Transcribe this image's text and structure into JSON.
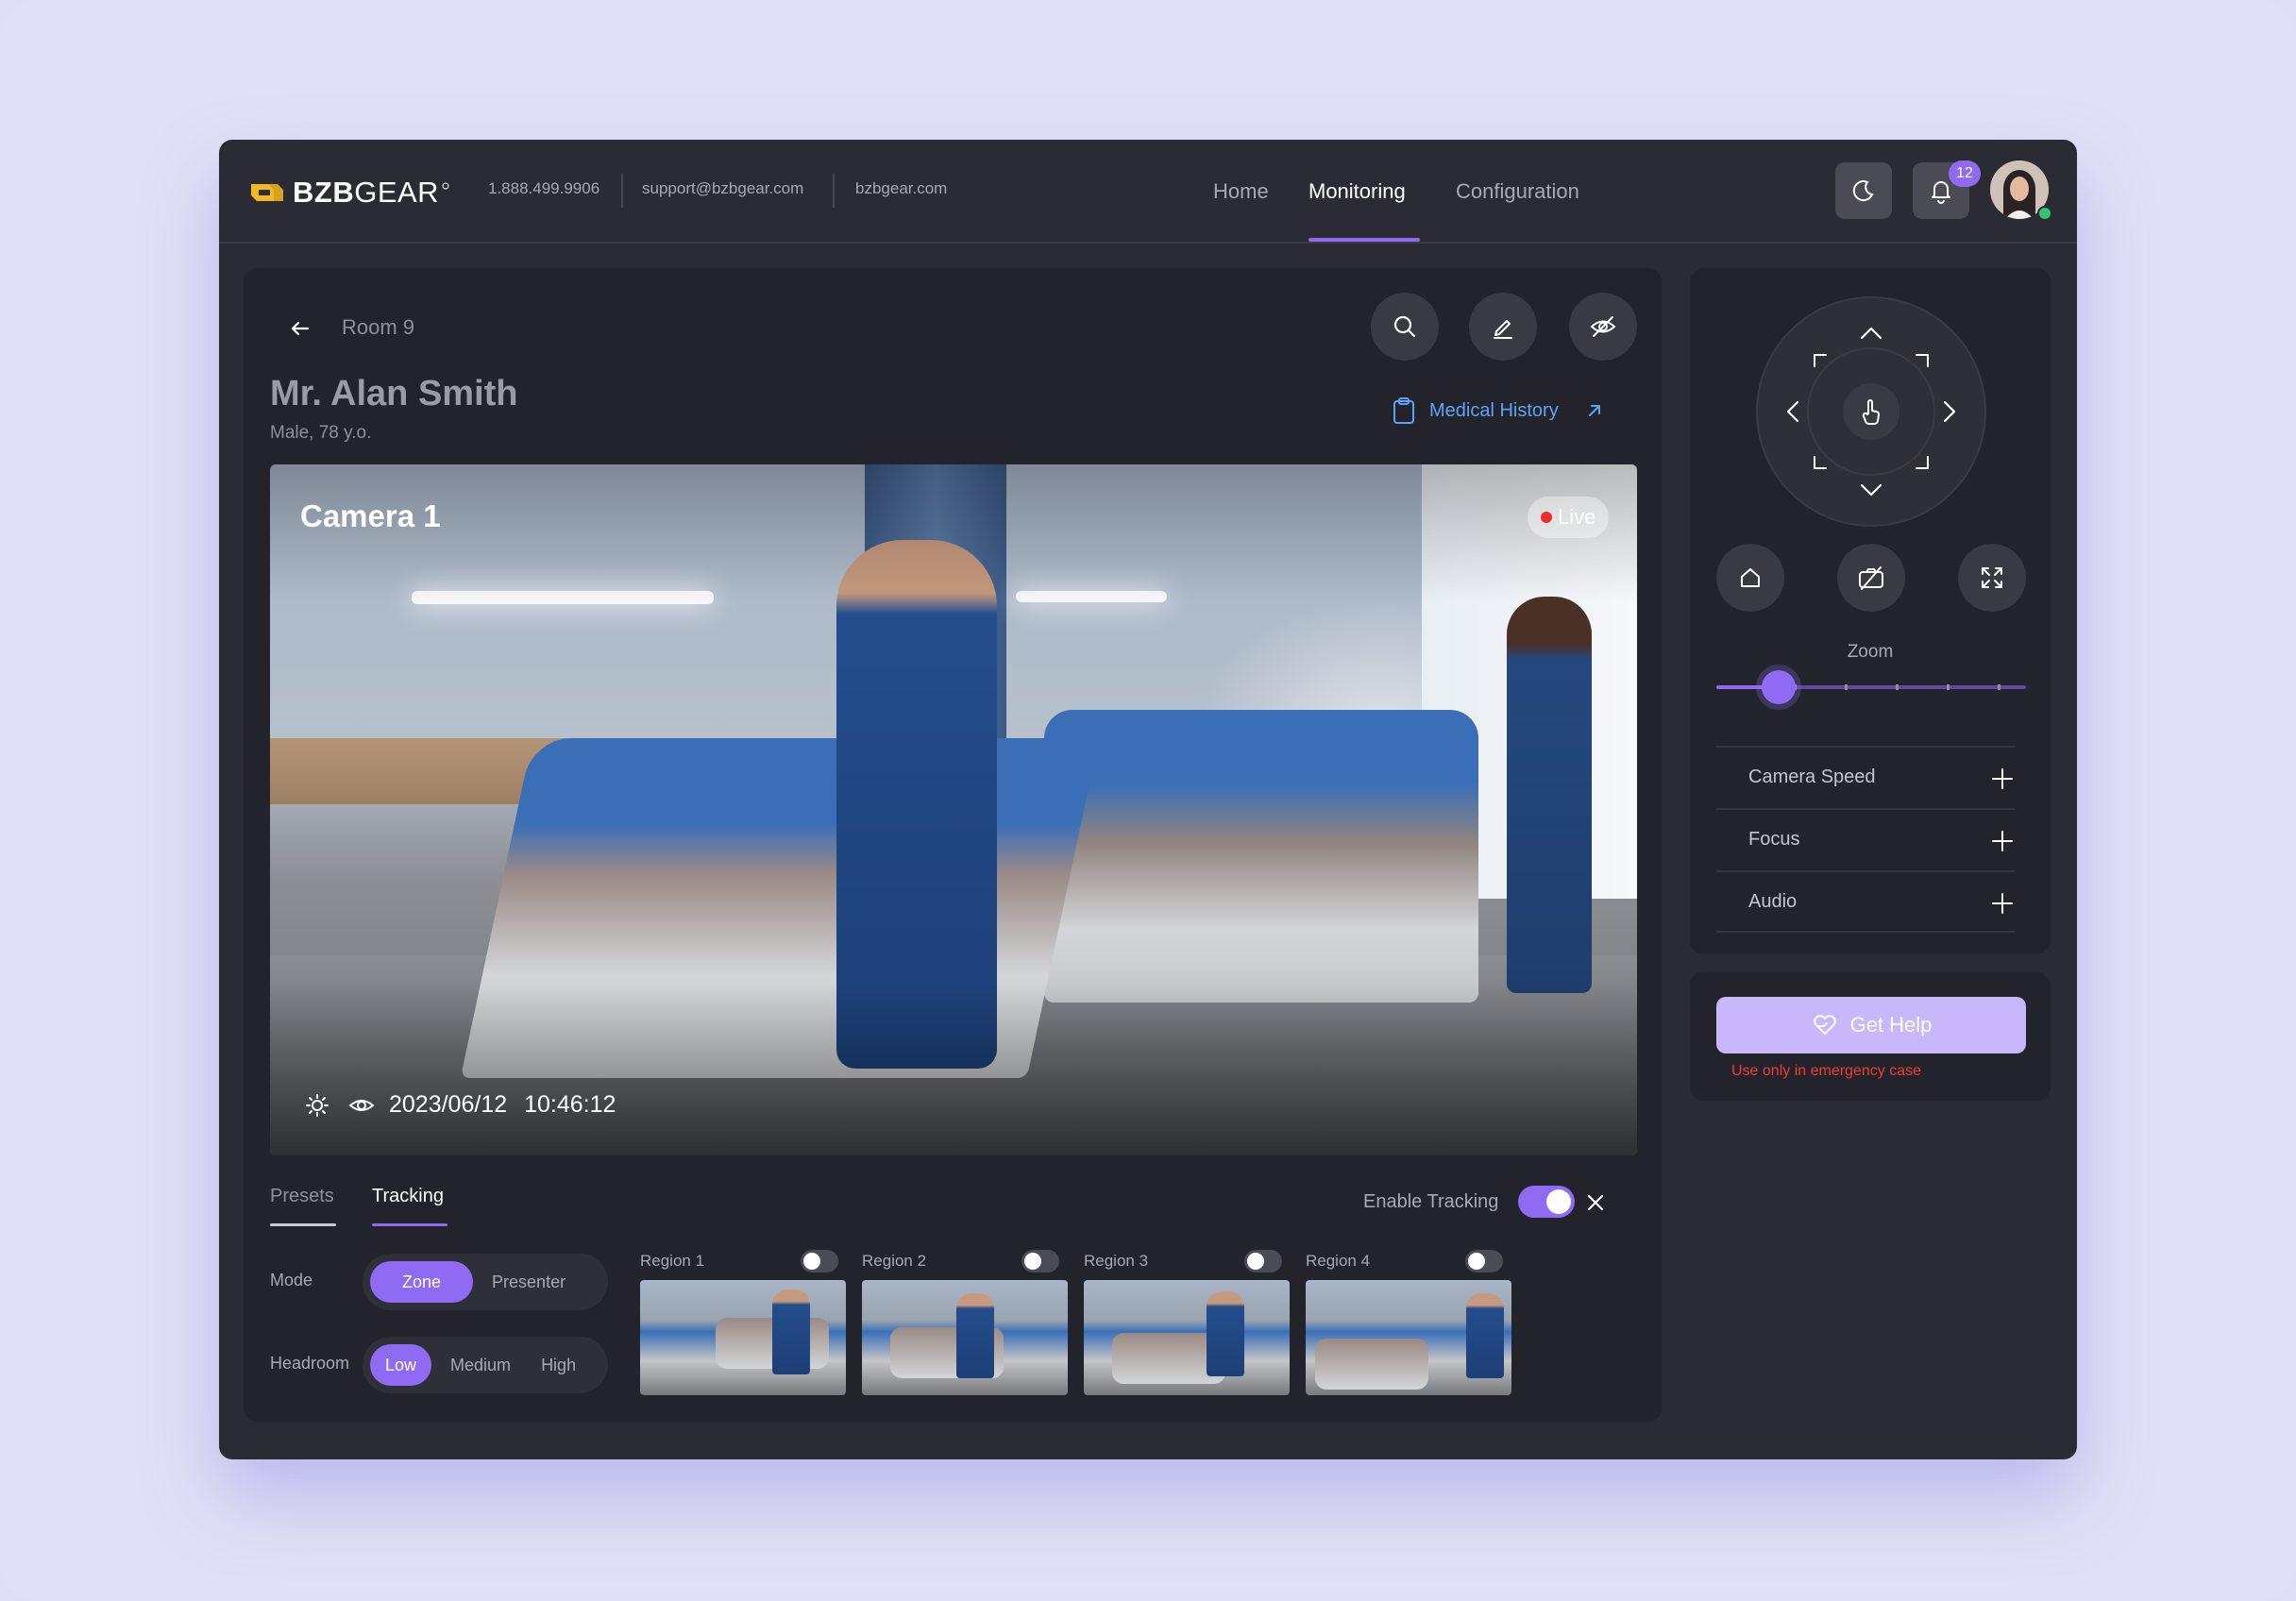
{
  "header": {
    "brand": "BZBGEAR",
    "brand_bold": "BZB",
    "brand_thin": "GEAR",
    "phone": "1.888.499.9906",
    "email": "support@bzbgear.com",
    "website": "bzbgear.com",
    "nav": [
      {
        "label": "Home",
        "active": false
      },
      {
        "label": "Monitoring",
        "active": true
      },
      {
        "label": "Configuration",
        "active": false
      }
    ],
    "notification_count": "12",
    "theme_icon": "moon-icon",
    "bell_icon": "bell-icon"
  },
  "room": {
    "back_icon": "arrow-left-icon",
    "label": "Room 9",
    "actions": [
      "search-icon",
      "edit-icon",
      "eye-off-icon"
    ]
  },
  "patient": {
    "name": "Mr. Alan Smith",
    "details": "Male, 78 y.o.",
    "medical_history_label": "Medical History"
  },
  "camera": {
    "title": "Camera 1",
    "live_label": "Live",
    "date": "2023/06/12",
    "time": "10:46:12"
  },
  "tabs": [
    {
      "label": "Presets",
      "active": false
    },
    {
      "label": "Tracking",
      "active": true
    }
  ],
  "tracking": {
    "enable_label": "Enable Tracking",
    "enabled": true,
    "mode_label": "Mode",
    "mode_options": [
      "Zone",
      "Presenter"
    ],
    "mode_selected": "Zone",
    "headroom_label": "Headroom",
    "headroom_options": [
      "Low",
      "Medium",
      "High"
    ],
    "headroom_selected": "Low",
    "regions": [
      {
        "label": "Region 1",
        "enabled": false
      },
      {
        "label": "Region 2",
        "enabled": false
      },
      {
        "label": "Region 3",
        "enabled": false
      },
      {
        "label": "Region 4",
        "enabled": false
      }
    ]
  },
  "controls": {
    "zoom_label": "Zoom",
    "zoom_level": 0.2,
    "buttons": [
      "home-icon",
      "camera-off-icon",
      "fullscreen-icon"
    ],
    "accordion": [
      {
        "label": "Camera Speed"
      },
      {
        "label": "Focus"
      },
      {
        "label": "Audio"
      }
    ]
  },
  "help": {
    "button_label": "Get Help",
    "note": "Use only in emergency case"
  },
  "colors": {
    "accent": "#8e6bf2",
    "link": "#5da3f5",
    "live": "#ef2b2b",
    "warning": "#ef3b3b",
    "help_button": "#c9b7fb"
  }
}
